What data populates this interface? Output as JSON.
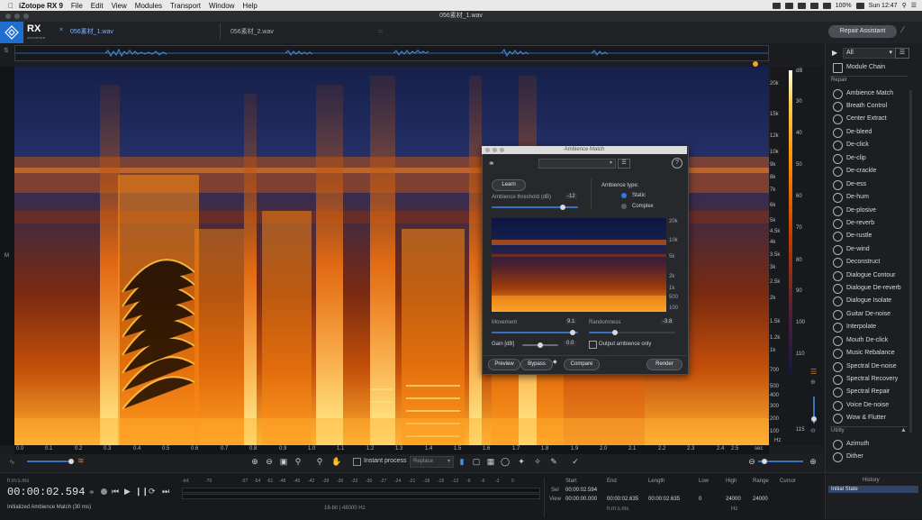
{
  "menubar": {
    "app": "iZotope RX 9",
    "items": [
      "File",
      "Edit",
      "View",
      "Modules",
      "Transport",
      "Window",
      "Help"
    ],
    "battery": "100%",
    "clock": "Sun 12:47"
  },
  "window": {
    "title": "056素材_1.wav"
  },
  "tabs": [
    {
      "label": "056素材_1.wav"
    },
    {
      "label": "056素材_2.wav"
    }
  ],
  "logo": {
    "text": "RX",
    "sub": "ADVANCED"
  },
  "repair_assistant": "Repair Assistant",
  "freq_labels": [
    "20k",
    "15k",
    "12k",
    "10k",
    "9k",
    "8k",
    "7k",
    "6k",
    "5k",
    "4.5k",
    "4k",
    "3.5k",
    "3k",
    "2.5k",
    "2k",
    "1.5k",
    "1.2k",
    "1k",
    "700",
    "500",
    "400",
    "300",
    "200",
    "100"
  ],
  "db_labels": [
    "dB",
    "30",
    "40",
    "50",
    "60",
    "70",
    "80",
    "90",
    "100",
    "110",
    "115"
  ],
  "hz_unit": "Hz",
  "time_labels": [
    "0.0",
    "0.1",
    "0.2",
    "0.3",
    "0.4",
    "0.5",
    "0.6",
    "0.7",
    "0.8",
    "0.9",
    "1.0",
    "1.1",
    "1.2",
    "1.3",
    "1.4",
    "1.5",
    "1.6",
    "1.7",
    "1.8",
    "1.9",
    "2.0",
    "2.1",
    "2.2",
    "2.3",
    "2.4",
    "2.5"
  ],
  "time_unit": "sec",
  "left_marker": "M",
  "toolbar": {
    "instant_process": "Instant process",
    "mode": "Replace"
  },
  "transport": {
    "format_label": "h:m:s.ms",
    "time": "00:00:02.594",
    "status": "Initialized Ambience Match (30 ms)"
  },
  "meter": {
    "labels": [
      "-Inf.",
      "-70",
      "-57",
      "-54",
      "-51",
      "-48",
      "-45",
      "-42",
      "-39",
      "-36",
      "-33",
      "-30",
      "-27",
      "-24",
      "-21",
      "-18",
      "-15",
      "-12",
      "-9",
      "-6",
      "-3",
      "0"
    ],
    "format": "16-bit | 48000 Hz"
  },
  "selection": {
    "headers": [
      "Start",
      "End",
      "Length",
      "Low",
      "High",
      "Range",
      "Cursor"
    ],
    "sel_label": "Sel",
    "view_label": "View",
    "sel": [
      "00:00:02.594",
      "",
      "",
      ""
    ],
    "view": [
      "00:00:00.000",
      "00:00:02.635",
      "00:00:02.635",
      "0",
      "24000",
      "24000"
    ],
    "unit_time": "h:m:s.ms",
    "unit_hz": "Hz"
  },
  "history": {
    "title": "History",
    "items": [
      "Initial State"
    ]
  },
  "module_panel": {
    "filter": "All",
    "chain": "Module Chain",
    "repair_header": "Repair",
    "utility_header": "Utility",
    "repair": [
      "Ambience Match",
      "Breath Control",
      "Center Extract",
      "De-bleed",
      "De-click",
      "De-clip",
      "De-crackle",
      "De-ess",
      "De-hum",
      "De-plosive",
      "De-reverb",
      "De-rustle",
      "De-wind",
      "Deconstruct",
      "Dialogue Contour",
      "Dialogue De-reverb",
      "Dialogue Isolate",
      "Guitar De-noise",
      "Interpolate",
      "Mouth De-click",
      "Music Rebalance",
      "Spectral De-noise",
      "Spectral Recovery",
      "Spectral Repair",
      "Voice De-noise",
      "Wow & Flutter"
    ],
    "utility": [
      "Azimuth",
      "Dither"
    ]
  },
  "dialog": {
    "title": "Ambience Match",
    "learn": "Learn",
    "threshold_label": "Ambience threshold (dB)",
    "threshold_value": "-12",
    "type_label": "Ambience type:",
    "type_static": "Static",
    "type_complex": "Complex",
    "freq_labels": [
      "20k",
      "10k",
      "5k",
      "2k",
      "1k",
      "500",
      "100"
    ],
    "movement_label": "Movement",
    "movement_value": "9.1",
    "randomness_label": "Randomness",
    "randomness_value": "-3.8",
    "gain_label": "Gain [dB]",
    "gain_value": "0.0",
    "output_label": "Output ambience only",
    "preview": "Preview",
    "bypass": "Bypass",
    "compare": "Compare",
    "render": "Render"
  }
}
